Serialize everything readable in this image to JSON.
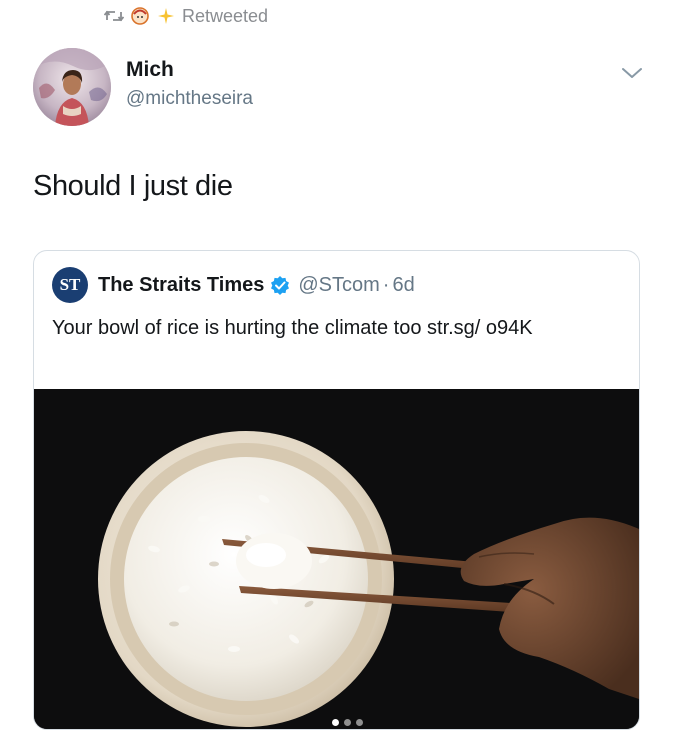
{
  "retweet": {
    "label": "Retweeted",
    "icon": "retweet-icon",
    "emoji_icons": [
      "face-emoji-icon",
      "sparkles-emoji-icon"
    ]
  },
  "author": {
    "name": "Mich",
    "handle": "@michtheseira",
    "avatar_icon": "user-avatar"
  },
  "tweet": {
    "text": "Should I just die"
  },
  "quoted": {
    "logo_text": "ST",
    "name": "The Straits Times",
    "verified_icon": "verified-badge-icon",
    "handle": "@STcom",
    "separator": "·",
    "time": "6d",
    "text": "Your bowl of rice is hurting the climate too str.sg/ o94K",
    "image": "bowl-of-rice-with-chopsticks-photo",
    "carousel": {
      "count": 3,
      "active": 1
    }
  },
  "colors": {
    "text": "#14171a",
    "secondary": "#657786",
    "verified": "#1da1f2",
    "retweet_gray": "#8a8d91",
    "card_border": "#d6dde3",
    "photo_background": "#0d0d0e"
  }
}
